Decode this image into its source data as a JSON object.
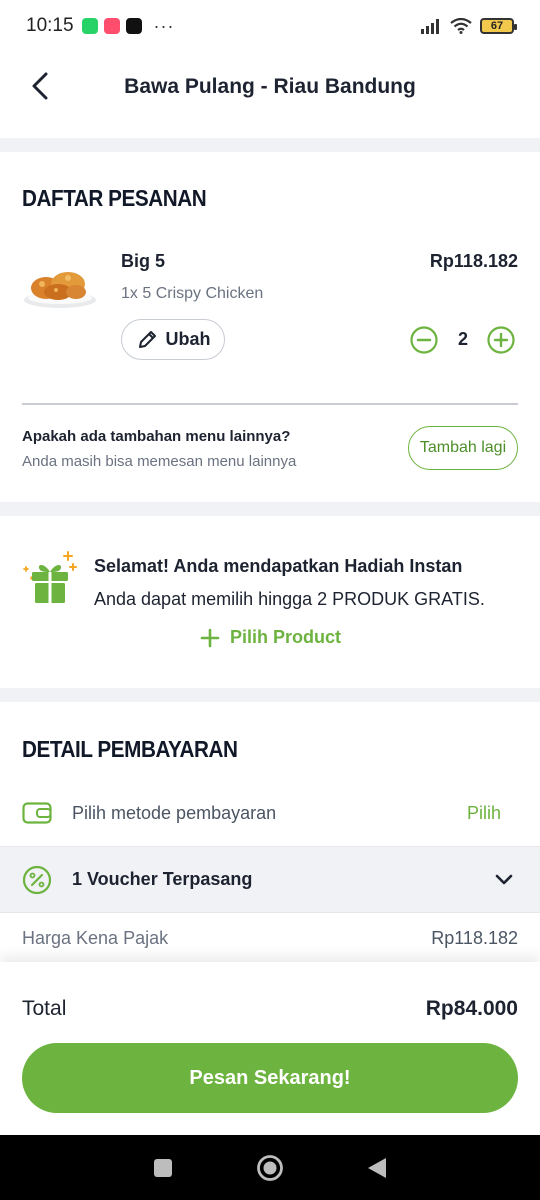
{
  "status_bar": {
    "time": "10:15",
    "battery": "67",
    "more": "···"
  },
  "header": {
    "title": "Bawa Pulang - Riau Bandung"
  },
  "order": {
    "section_title": "DAFTAR PESANAN",
    "item": {
      "name": "Big 5",
      "desc": "1x 5 Crispy Chicken",
      "price": "Rp118.182",
      "edit_label": "Ubah",
      "quantity": "2"
    },
    "add_more": {
      "question": "Apakah ada tambahan menu lainnya?",
      "subtitle": "Anda masih bisa memesan menu lainnya",
      "button_label": "Tambah lagi"
    }
  },
  "gift": {
    "title": "Selamat! Anda mendapatkan Hadiah Instan",
    "subtitle": "Anda dapat memilih hingga 2 PRODUK GRATIS.",
    "pick_label": "Pilih Product"
  },
  "payment": {
    "section_title": "DETAIL PEMBAYARAN",
    "method_label": "Pilih metode pembayaran",
    "method_action": "Pilih",
    "voucher_label": "1 Voucher Terpasang",
    "tax_label": "Harga Kena Pajak",
    "tax_value": "Rp118.182"
  },
  "summary": {
    "total_label": "Total",
    "total_value": "Rp84.000",
    "order_button": "Pesan Sekarang!"
  },
  "colors": {
    "accent": "#6db33f",
    "text": "#1d2330",
    "muted": "#6b7280",
    "gap": "#f1f2f5"
  }
}
